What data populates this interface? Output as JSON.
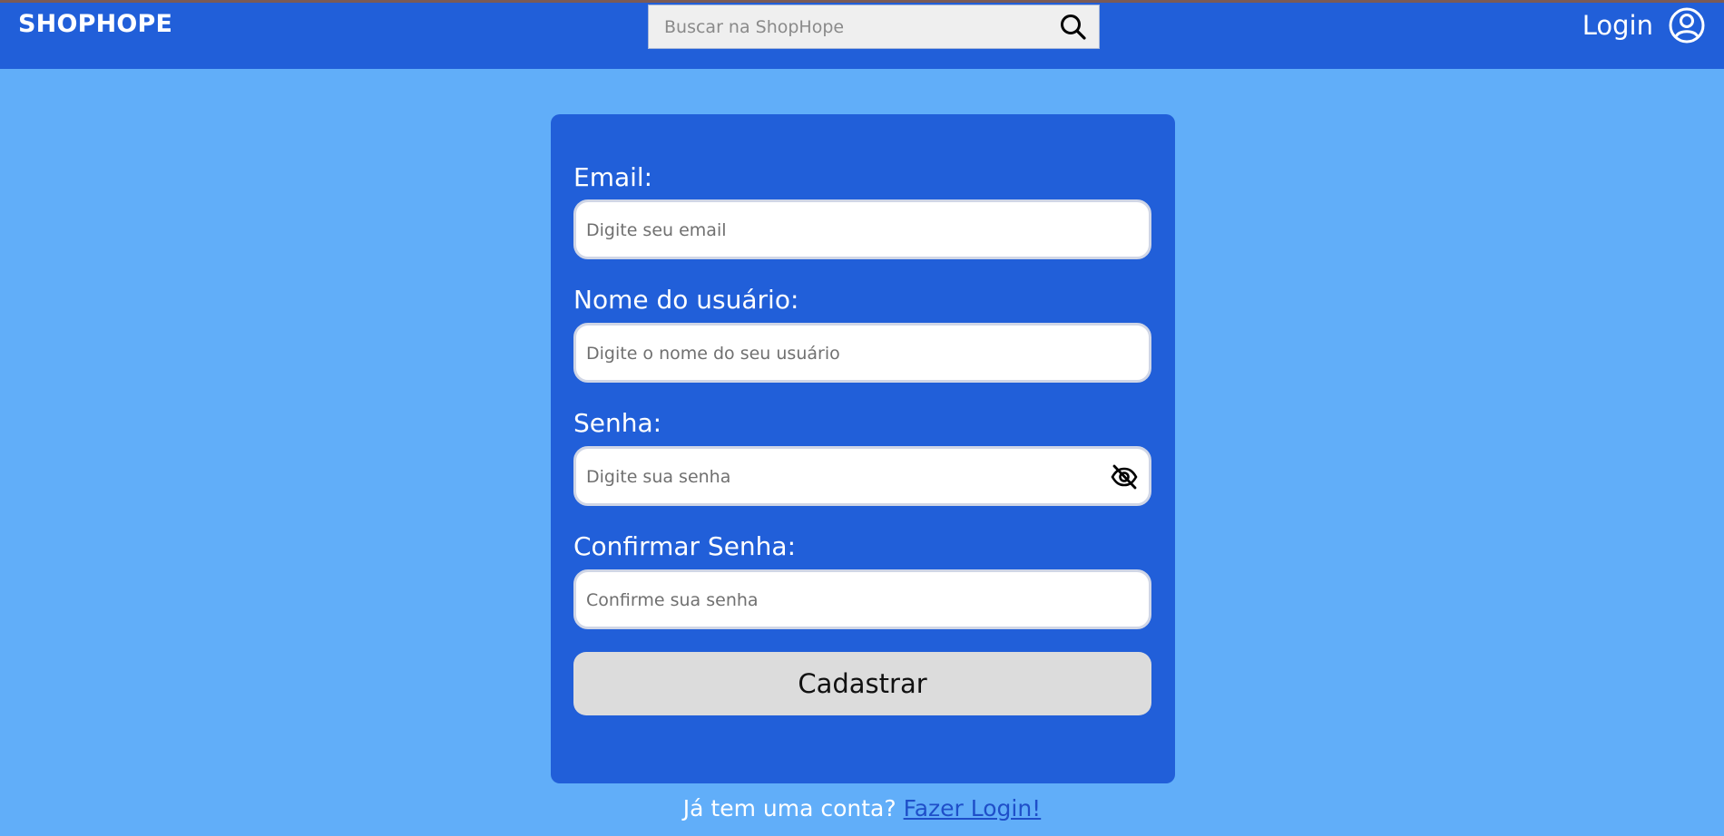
{
  "header": {
    "logo": "SHOPHOPE",
    "search_placeholder": "Buscar na ShopHope",
    "login_label": "Login"
  },
  "form": {
    "email_label": "Email:",
    "email_placeholder": "Digite seu email",
    "username_label": "Nome do usuário:",
    "username_placeholder": "Digite o nome do seu usuário",
    "password_label": "Senha:",
    "password_placeholder": "Digite sua senha",
    "confirm_label": "Confirmar Senha:",
    "confirm_placeholder": "Confirme sua senha",
    "submit_label": "Cadastrar"
  },
  "footer": {
    "prompt": "Já tem uma conta?",
    "link": "Fazer Login!"
  },
  "icons": {
    "search": "search-icon",
    "user": "user-circle-icon",
    "password_toggle": "eye-off-icon"
  },
  "colors": {
    "page_background": "#61aef9",
    "header_background": "#215fd9",
    "card_background": "#215fd9",
    "button_background": "#dcdcdc"
  }
}
